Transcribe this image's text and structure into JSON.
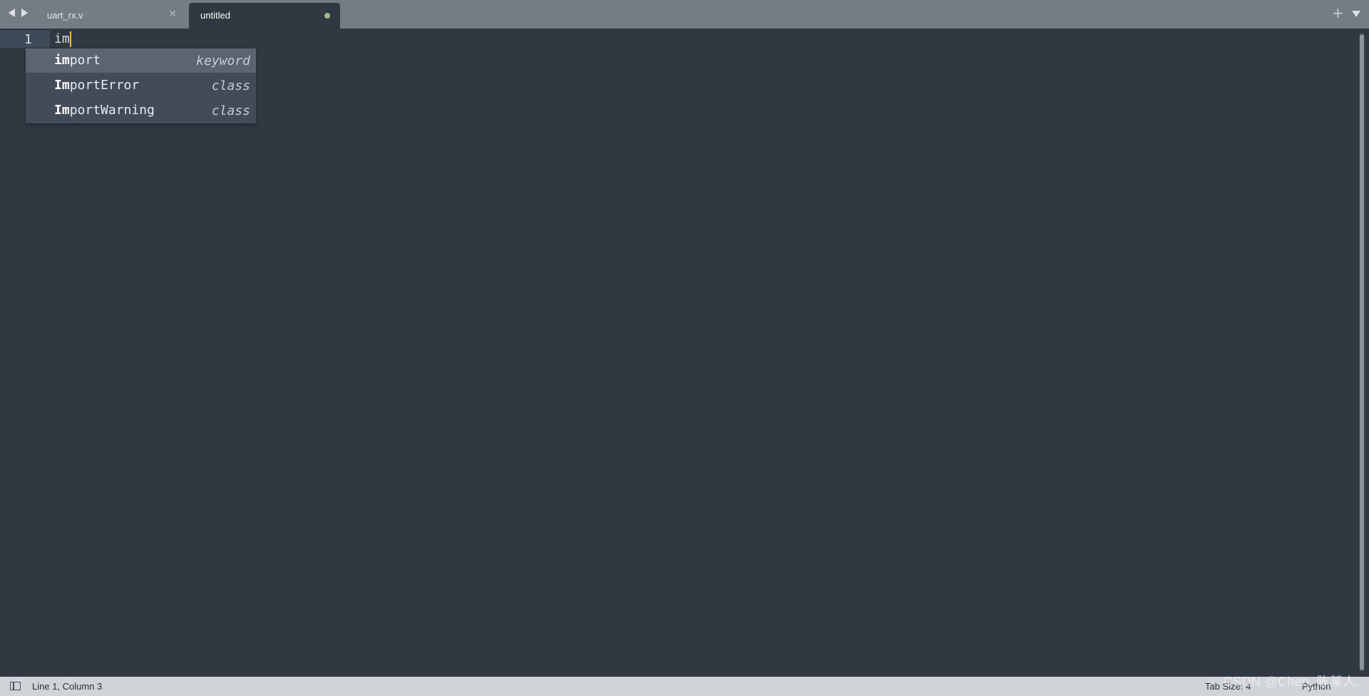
{
  "tabs": [
    {
      "label": "uart_rx.v",
      "active": false,
      "close_icon": "close-icon"
    },
    {
      "label": "untitled",
      "active": true,
      "dirty_indicator": "unsaved-dot-icon"
    }
  ],
  "editor": {
    "line_number": "1",
    "line_text": "im",
    "cursor_color": "#f9ae58"
  },
  "autocomplete": {
    "items": [
      {
        "match": "im",
        "rest": "port",
        "kind": "keyword",
        "selected": true
      },
      {
        "match": "Im",
        "rest": "portError",
        "kind": "class",
        "selected": false
      },
      {
        "match": "Im",
        "rest": "portWarning",
        "kind": "class",
        "selected": false
      }
    ]
  },
  "status_bar": {
    "position": "Line 1, Column 3",
    "tab_size": "Tab Size: 4",
    "syntax": "Python"
  },
  "watermark": "CSDN @Chen_陈某人.",
  "colors": {
    "editor_bg": "#303841",
    "tabbar_bg": "#747c86",
    "statusbar_bg": "#d0d3d8",
    "popup_bg": "#414c58",
    "popup_selected": "#5b6470"
  }
}
